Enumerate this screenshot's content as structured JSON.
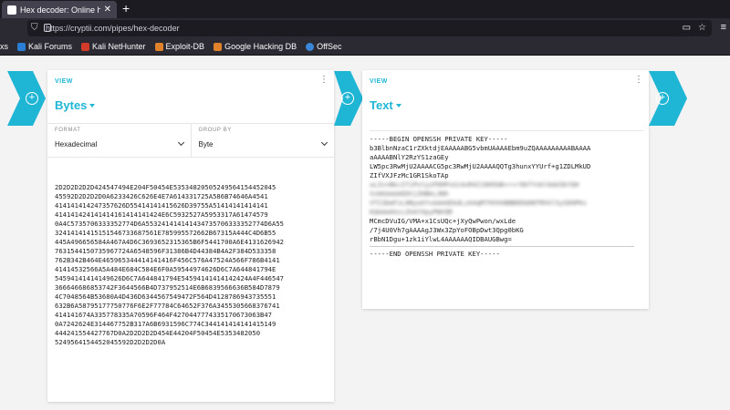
{
  "browser": {
    "tab_title": "Hex decoder: Online hexa",
    "tab_close": "✕",
    "new_tab": "+",
    "url": "https://cryptii.com/pipes/hex-decoder",
    "bookmarks": [
      {
        "label": "xs",
        "icon": "bookmark-icon",
        "color": "#1c1b22"
      },
      {
        "label": "Kali Forums",
        "icon": "kali-icon",
        "color": "#2a7fd4"
      },
      {
        "label": "Kali NetHunter",
        "icon": "nethunter-icon",
        "color": "#d23a2a"
      },
      {
        "label": "Exploit-DB",
        "icon": "exploit-db-icon",
        "color": "#e0822b"
      },
      {
        "label": "Google Hacking DB",
        "icon": "ghdb-icon",
        "color": "#e0822b"
      },
      {
        "label": "OffSec",
        "icon": "offsec-icon",
        "color": "#3a86d8"
      }
    ]
  },
  "theme": {
    "accent": "#1fb6d6"
  },
  "bytes_card": {
    "view_label": "VIEW",
    "title": "Bytes",
    "format_label": "FORMAT",
    "format_value": "Hexadecimal",
    "group_label": "GROUP BY",
    "group_value": "Byte",
    "hex_lines": [
      "2D2D2D2D2D424547494E204F50454E53534820505249564154452045",
      "45592D2D2D2D0A6233426C626E4E7A614331725A586B74646A4541",
      "414141414247357626D55414141415626D39755A51414141414141",
      "414141424141414161414141424E6C5932527A5953317A61474579",
      "0A4C5735706333352774D6A553241414141434735706333352774D6A55",
      "32414141415151546733687561E785995572662B67315A444C4D6B55",
      "445A496656584A467A4D6C3693652315365B6F5441700A6E4131626942",
      "7631544150735967724A6548596F31386B4D44384B4A2F384D533358",
      "762B342B464E465965344414141416F456C576A47524A566F786B4141",
      "41414532566A5A484E684C584E6F0A59544974626D6C7A644841794E",
      "54594141414149626D6C7A644841794E54594141414142424A4F446547",
      "366646686853742F3644566B4D737952514E6B6839566636B584D7879",
      "4C7048564B53680A4D436D6344567549472F564D4128786943735551",
      "632B6A58795177750776F6E2F77784C64652F376A3455305668376741",
      "414141674A335778335A70596F464F4270447774335170673063B47",
      "0A7242624E314467752B317A6B6931596C774C344141414141415149",
      "444241554427767D0A2D2D2D2D454E44204F50454E5353482050",
      "5249564154452045592D2D2D2D0A"
    ]
  },
  "text_card": {
    "view_label": "VIEW",
    "title": "Text",
    "text_lines": [
      "-----BEGIN OPENSSH PRIVATE KEY-----",
      "b3BlbnNzaC1rZXktdjEAAAAABG5vbmUAAAAEbm9uZQAAAAAAAAABAAAA",
      "aAAAABNlY2RzYS1zaGEy",
      "LW5pc3RwMjU2AAAACG5pc3RwMjU2AAAAQQTg3hunxYYUrf+g1ZDLMkUD",
      "ZIfVXJFzMc1GR1SkoTAp",
      "uLIn+BkcIfiPvtyzPOHPsUi4xR4I18H5bB+r+r96fYnbl6dd3bYQH",
      "VvbKAAAAEDVjZHBkL3Nh",
      "VTI3bmFzL0NyaXYvAAAAEbdLzA4qM7hhhhBBBDDbDNTRhhl5ySDHPKs",
      "KQAAAAhzc2hAYXpyPWVQR",
      "MCmcDVuIG/VMA+x1CsUQc+jXyQwPwon/wxLde",
      "/7j4U0Vh7gAAAAgJ3Wx3ZpYoFOBpDwt3Qpg0bKG",
      "rBbN1Dgu+1zk1iYlwL4AAAAAAQIDBAUGBwg=",
      "-----END OPENSSH PRIVATE KEY-----"
    ]
  }
}
